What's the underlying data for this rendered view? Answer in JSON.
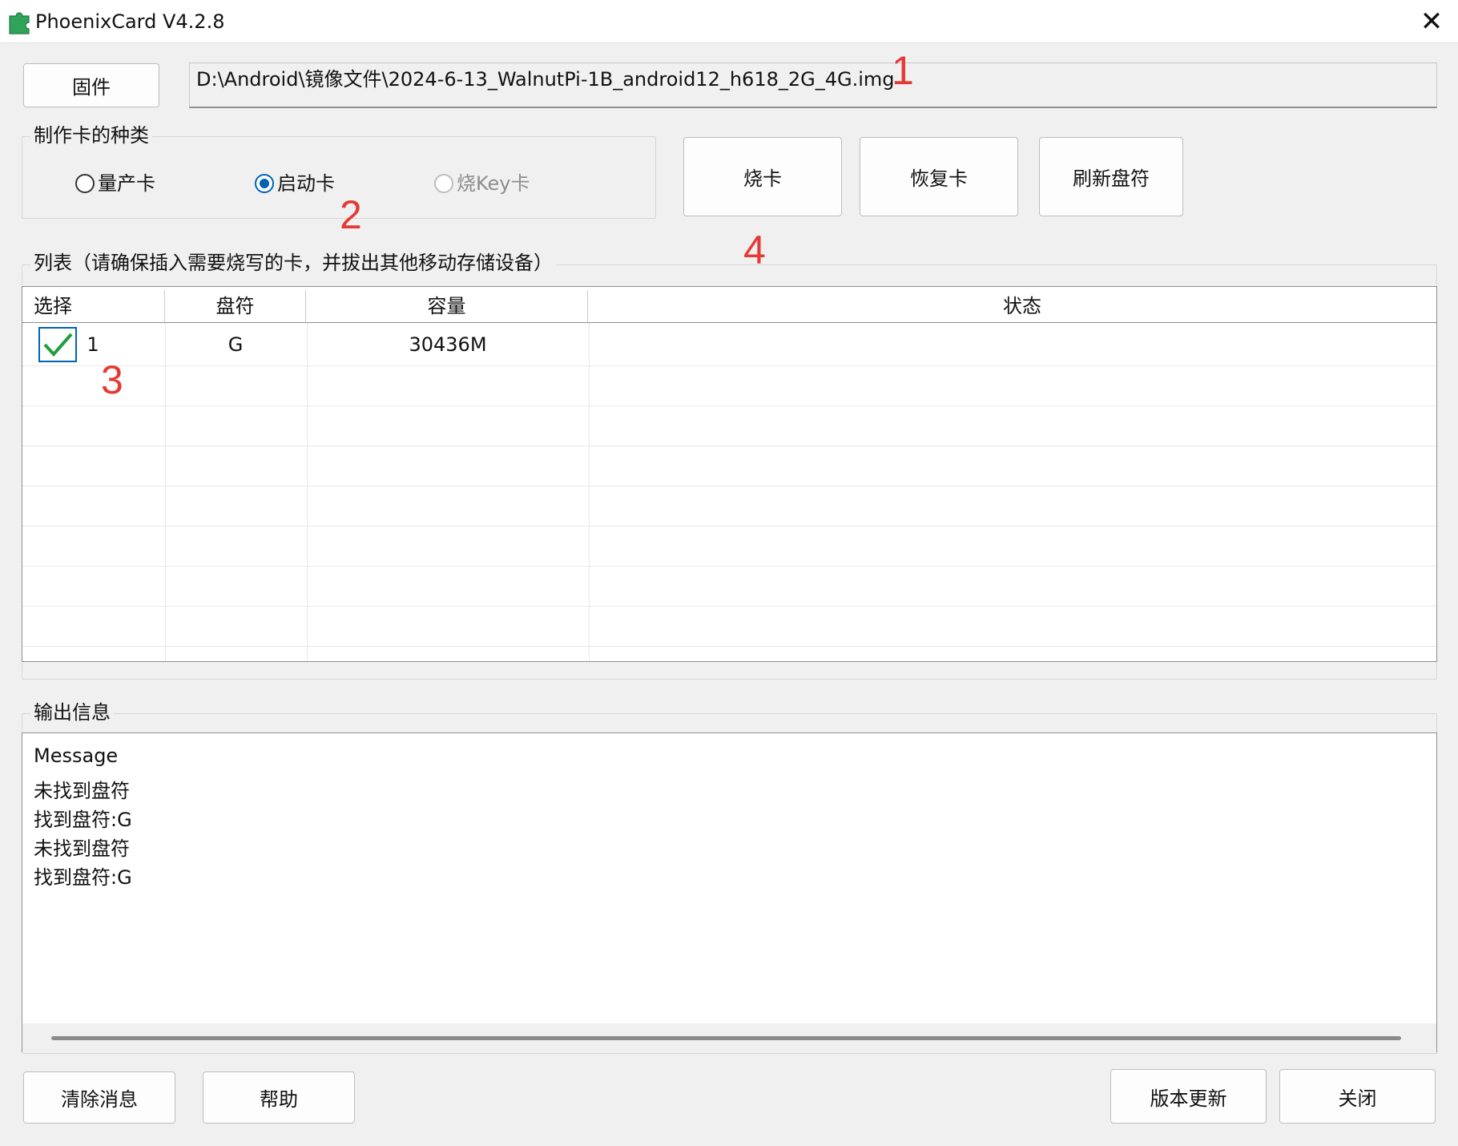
{
  "window": {
    "title": "PhoenixCard V4.2.8",
    "close_glyph": "✕"
  },
  "firmware": {
    "button_label": "固件",
    "path": "D:\\Android\\镜像文件\\2024-6-13_WalnutPi-1B_android12_h618_2G_4G.img"
  },
  "card_type": {
    "legend": "制作卡的种类",
    "options": [
      {
        "label": "量产卡",
        "checked": false,
        "disabled": false
      },
      {
        "label": "启动卡",
        "checked": true,
        "disabled": false
      },
      {
        "label": "烧Key卡",
        "checked": false,
        "disabled": true
      }
    ]
  },
  "actions": {
    "burn": "烧卡",
    "restore": "恢复卡",
    "refresh": "刷新盘符"
  },
  "list": {
    "legend": "列表（请确保插入需要烧写的卡，并拔出其他移动存储设备）",
    "columns": [
      "选择",
      "盘符",
      "容量",
      "状态"
    ],
    "rows": [
      {
        "index": "1",
        "selected": true,
        "drive": "G",
        "capacity": "30436M",
        "status": ""
      }
    ]
  },
  "output": {
    "legend": "输出信息",
    "messages": [
      "Message",
      "未找到盘符",
      "找到盘符:G",
      "未找到盘符",
      "找到盘符:G"
    ]
  },
  "footer": {
    "clear": "清除消息",
    "help": "帮助",
    "update": "版本更新",
    "close": "关闭"
  },
  "annotations": [
    "1",
    "2",
    "3",
    "4"
  ],
  "colors": {
    "accent": "#0063b1",
    "annotation": "#e53935",
    "check": "#1e9e3e"
  }
}
